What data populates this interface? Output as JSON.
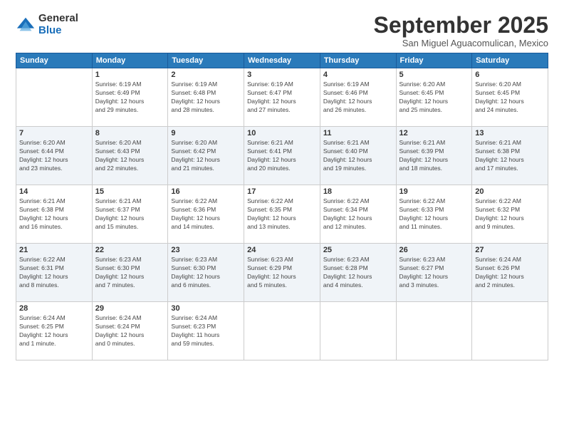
{
  "logo": {
    "general": "General",
    "blue": "Blue"
  },
  "header": {
    "month": "September 2025",
    "location": "San Miguel Aguacomulican, Mexico"
  },
  "weekdays": [
    "Sunday",
    "Monday",
    "Tuesday",
    "Wednesday",
    "Thursday",
    "Friday",
    "Saturday"
  ],
  "weeks": [
    [
      {
        "day": "",
        "info": ""
      },
      {
        "day": "1",
        "info": "Sunrise: 6:19 AM\nSunset: 6:49 PM\nDaylight: 12 hours\nand 29 minutes."
      },
      {
        "day": "2",
        "info": "Sunrise: 6:19 AM\nSunset: 6:48 PM\nDaylight: 12 hours\nand 28 minutes."
      },
      {
        "day": "3",
        "info": "Sunrise: 6:19 AM\nSunset: 6:47 PM\nDaylight: 12 hours\nand 27 minutes."
      },
      {
        "day": "4",
        "info": "Sunrise: 6:19 AM\nSunset: 6:46 PM\nDaylight: 12 hours\nand 26 minutes."
      },
      {
        "day": "5",
        "info": "Sunrise: 6:20 AM\nSunset: 6:45 PM\nDaylight: 12 hours\nand 25 minutes."
      },
      {
        "day": "6",
        "info": "Sunrise: 6:20 AM\nSunset: 6:45 PM\nDaylight: 12 hours\nand 24 minutes."
      }
    ],
    [
      {
        "day": "7",
        "info": "Sunrise: 6:20 AM\nSunset: 6:44 PM\nDaylight: 12 hours\nand 23 minutes."
      },
      {
        "day": "8",
        "info": "Sunrise: 6:20 AM\nSunset: 6:43 PM\nDaylight: 12 hours\nand 22 minutes."
      },
      {
        "day": "9",
        "info": "Sunrise: 6:20 AM\nSunset: 6:42 PM\nDaylight: 12 hours\nand 21 minutes."
      },
      {
        "day": "10",
        "info": "Sunrise: 6:21 AM\nSunset: 6:41 PM\nDaylight: 12 hours\nand 20 minutes."
      },
      {
        "day": "11",
        "info": "Sunrise: 6:21 AM\nSunset: 6:40 PM\nDaylight: 12 hours\nand 19 minutes."
      },
      {
        "day": "12",
        "info": "Sunrise: 6:21 AM\nSunset: 6:39 PM\nDaylight: 12 hours\nand 18 minutes."
      },
      {
        "day": "13",
        "info": "Sunrise: 6:21 AM\nSunset: 6:38 PM\nDaylight: 12 hours\nand 17 minutes."
      }
    ],
    [
      {
        "day": "14",
        "info": "Sunrise: 6:21 AM\nSunset: 6:38 PM\nDaylight: 12 hours\nand 16 minutes."
      },
      {
        "day": "15",
        "info": "Sunrise: 6:21 AM\nSunset: 6:37 PM\nDaylight: 12 hours\nand 15 minutes."
      },
      {
        "day": "16",
        "info": "Sunrise: 6:22 AM\nSunset: 6:36 PM\nDaylight: 12 hours\nand 14 minutes."
      },
      {
        "day": "17",
        "info": "Sunrise: 6:22 AM\nSunset: 6:35 PM\nDaylight: 12 hours\nand 13 minutes."
      },
      {
        "day": "18",
        "info": "Sunrise: 6:22 AM\nSunset: 6:34 PM\nDaylight: 12 hours\nand 12 minutes."
      },
      {
        "day": "19",
        "info": "Sunrise: 6:22 AM\nSunset: 6:33 PM\nDaylight: 12 hours\nand 11 minutes."
      },
      {
        "day": "20",
        "info": "Sunrise: 6:22 AM\nSunset: 6:32 PM\nDaylight: 12 hours\nand 9 minutes."
      }
    ],
    [
      {
        "day": "21",
        "info": "Sunrise: 6:22 AM\nSunset: 6:31 PM\nDaylight: 12 hours\nand 8 minutes."
      },
      {
        "day": "22",
        "info": "Sunrise: 6:23 AM\nSunset: 6:30 PM\nDaylight: 12 hours\nand 7 minutes."
      },
      {
        "day": "23",
        "info": "Sunrise: 6:23 AM\nSunset: 6:30 PM\nDaylight: 12 hours\nand 6 minutes."
      },
      {
        "day": "24",
        "info": "Sunrise: 6:23 AM\nSunset: 6:29 PM\nDaylight: 12 hours\nand 5 minutes."
      },
      {
        "day": "25",
        "info": "Sunrise: 6:23 AM\nSunset: 6:28 PM\nDaylight: 12 hours\nand 4 minutes."
      },
      {
        "day": "26",
        "info": "Sunrise: 6:23 AM\nSunset: 6:27 PM\nDaylight: 12 hours\nand 3 minutes."
      },
      {
        "day": "27",
        "info": "Sunrise: 6:24 AM\nSunset: 6:26 PM\nDaylight: 12 hours\nand 2 minutes."
      }
    ],
    [
      {
        "day": "28",
        "info": "Sunrise: 6:24 AM\nSunset: 6:25 PM\nDaylight: 12 hours\nand 1 minute."
      },
      {
        "day": "29",
        "info": "Sunrise: 6:24 AM\nSunset: 6:24 PM\nDaylight: 12 hours\nand 0 minutes."
      },
      {
        "day": "30",
        "info": "Sunrise: 6:24 AM\nSunset: 6:23 PM\nDaylight: 11 hours\nand 59 minutes."
      },
      {
        "day": "",
        "info": ""
      },
      {
        "day": "",
        "info": ""
      },
      {
        "day": "",
        "info": ""
      },
      {
        "day": "",
        "info": ""
      }
    ]
  ],
  "row_shades": [
    "white",
    "shade",
    "white",
    "shade",
    "white"
  ]
}
